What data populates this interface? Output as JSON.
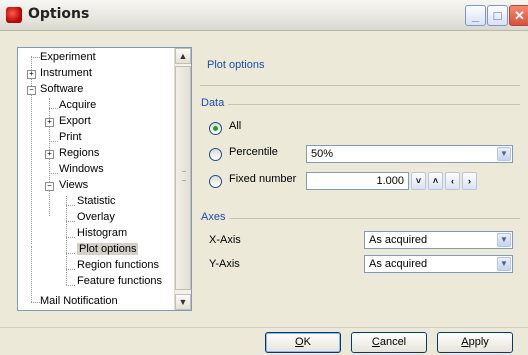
{
  "window": {
    "title": "Options"
  },
  "tree": {
    "items": [
      {
        "label": "Experiment"
      },
      {
        "label": "Instrument"
      },
      {
        "label": "Software"
      },
      {
        "label": "Acquire"
      },
      {
        "label": "Export"
      },
      {
        "label": "Print"
      },
      {
        "label": "Regions"
      },
      {
        "label": "Windows"
      },
      {
        "label": "Views"
      },
      {
        "label": "Statistic"
      },
      {
        "label": "Overlay"
      },
      {
        "label": "Histogram"
      },
      {
        "label": "Plot options",
        "selected": true
      },
      {
        "label": "Region functions"
      },
      {
        "label": "Feature functions"
      },
      {
        "label": "Mail Notification"
      }
    ]
  },
  "panel": {
    "title": "Plot options",
    "data_group": {
      "title": "Data",
      "options": [
        {
          "label": "All",
          "checked": true
        },
        {
          "label": "Percentile",
          "checked": false
        },
        {
          "label": "Fixed number",
          "checked": false
        }
      ],
      "percentile_value": "50%",
      "fixed_number_value": "1.000"
    },
    "axes_group": {
      "title": "Axes",
      "x_axis": {
        "label": "X-Axis",
        "value": "As acquired"
      },
      "y_axis": {
        "label": "Y-Axis",
        "value": "As acquired"
      }
    }
  },
  "buttons": {
    "ok": {
      "mnemonic": "O",
      "rest": "K"
    },
    "cancel": {
      "mnemonic": "C",
      "rest": "ancel"
    },
    "apply": {
      "mnemonic": "A",
      "rest": "pply"
    }
  },
  "colors": {
    "accent": "#1b4bb0",
    "dialog_bg": "#ece9d8",
    "selection": "#d4d0c8"
  }
}
